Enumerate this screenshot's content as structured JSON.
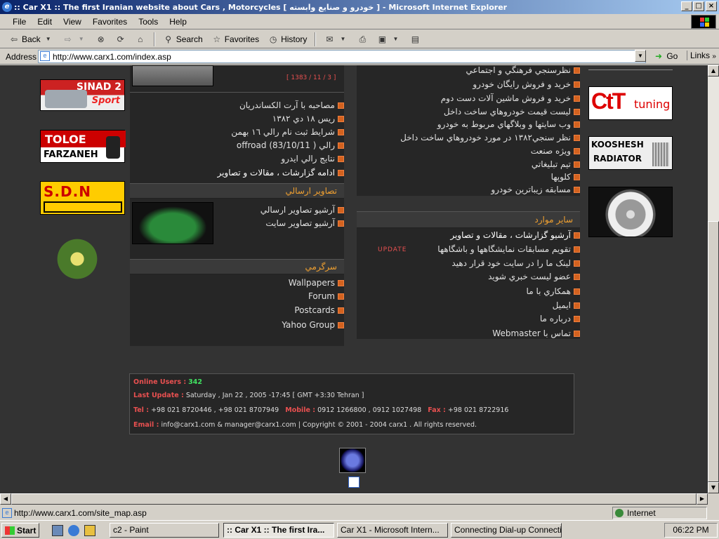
{
  "window": {
    "title": ":: Car X1 :: The first Iranian website about Cars , Motorcycles [ خودرو و صنایع وابسته ] - Microsoft Internet Explorer",
    "min": "_",
    "max": "□",
    "close": "×"
  },
  "menu": [
    "File",
    "Edit",
    "View",
    "Favorites",
    "Tools",
    "Help"
  ],
  "toolbar": {
    "back": "Back",
    "search": "Search",
    "favorites": "Favorites",
    "history": "History"
  },
  "address": {
    "label": "Address",
    "url": "http://www.carx1.com/index.asp",
    "go": "Go",
    "links": "Links"
  },
  "left_banners": [
    {
      "text1": "SINAD 2",
      "text2": "Sport"
    },
    {
      "text1": "TOLOE",
      "text2": "FARZANEH"
    },
    {
      "text1": "S.D.N"
    }
  ],
  "center": {
    "date": "[ 1383 / 11 / 3 ]",
    "news": [
      "مصاحبه با آرت الكساندريان",
      "ريس ١٨ دي ١٣٨٢",
      "شرايط ثبت نام رالي ١٦ بهمن",
      "رالي ( offroad (83/10/11",
      "نتايج رالي ايدرو",
      "ادامه گزارشات ، مقالات و تصاوير"
    ],
    "photos_head": "تصاوير ارسالي",
    "photos": [
      "آرشيو تصاوير  ارسالي",
      "آرشيو تصاوير سايت"
    ],
    "fun_head": "سرگرمي",
    "fun": [
      "Wallpapers",
      "Forum",
      "Postcards",
      "Yahoo Group"
    ]
  },
  "right": {
    "top_items": [
      "نظرسنجي فرهنگي و اجتماعي",
      "خريد و فروش رايگان خودرو",
      "خريد و فروش ماشين آلات دست دوم",
      "ليست قيمت خودروهاي ساخت داخل",
      "وب سايتها و وبلاگهاي مربوط به خودرو",
      "نظر سنجي١٣٨٢ در مورد خودروهاي ساخت داخل",
      "ويژه صنعت",
      "تيم تبليغاتي",
      "كلوپها",
      "مسابقه زيباترين خودرو"
    ],
    "other_head": "ساير موارد",
    "other_items": [
      "آرشيو گزارشات ، مقالات و تصاوير",
      "تقويم مسابقات  نمايشگاهها و باشگاهها",
      "لينک ما را در سايت خود قرار دهيد",
      "عضو ليست خبري شويد",
      "همكاري با ما",
      "ايميل",
      "درباره ما",
      "تماس با Webmaster"
    ],
    "update_badge": "UPDATE"
  },
  "right_banners": [
    {
      "text1": "CtT",
      "text2": "tuning"
    },
    {
      "text1": "KOOSHESH",
      "text2": "RADIATOR"
    }
  ],
  "footer": {
    "online_label": "Online Users :",
    "online_value": "342",
    "update_label": "Last Update :",
    "update_value": "Saturday , Jan  22 , 2005 -17:45 [ GMT +3:30  Tehran ]",
    "tel_label": "Tel :",
    "tel_value": "+98 021 8720446 , +98 021 8707949",
    "mobile_label": "Mobile :",
    "mobile_value": "0912 1266800 , 0912 1027498",
    "fax_label": "Fax :",
    "fax_value": "+98 021 8722916",
    "email_label": "Email :",
    "email_value": "info@carx1.com  &  manager@carx1.com  |  Copyright © 2001 - 2004  carx1 . All rights reserved."
  },
  "status": {
    "url": "http://www.carx1.com/site_map.asp",
    "zone": "Internet"
  },
  "taskbar": {
    "start": "Start",
    "tasks": [
      "c2 - Paint",
      ":: Car X1 :: The first Ira...",
      "Car X1 - Microsoft Intern...",
      "Connecting Dial-up Connectio..."
    ],
    "clock": "06:22 PM"
  }
}
